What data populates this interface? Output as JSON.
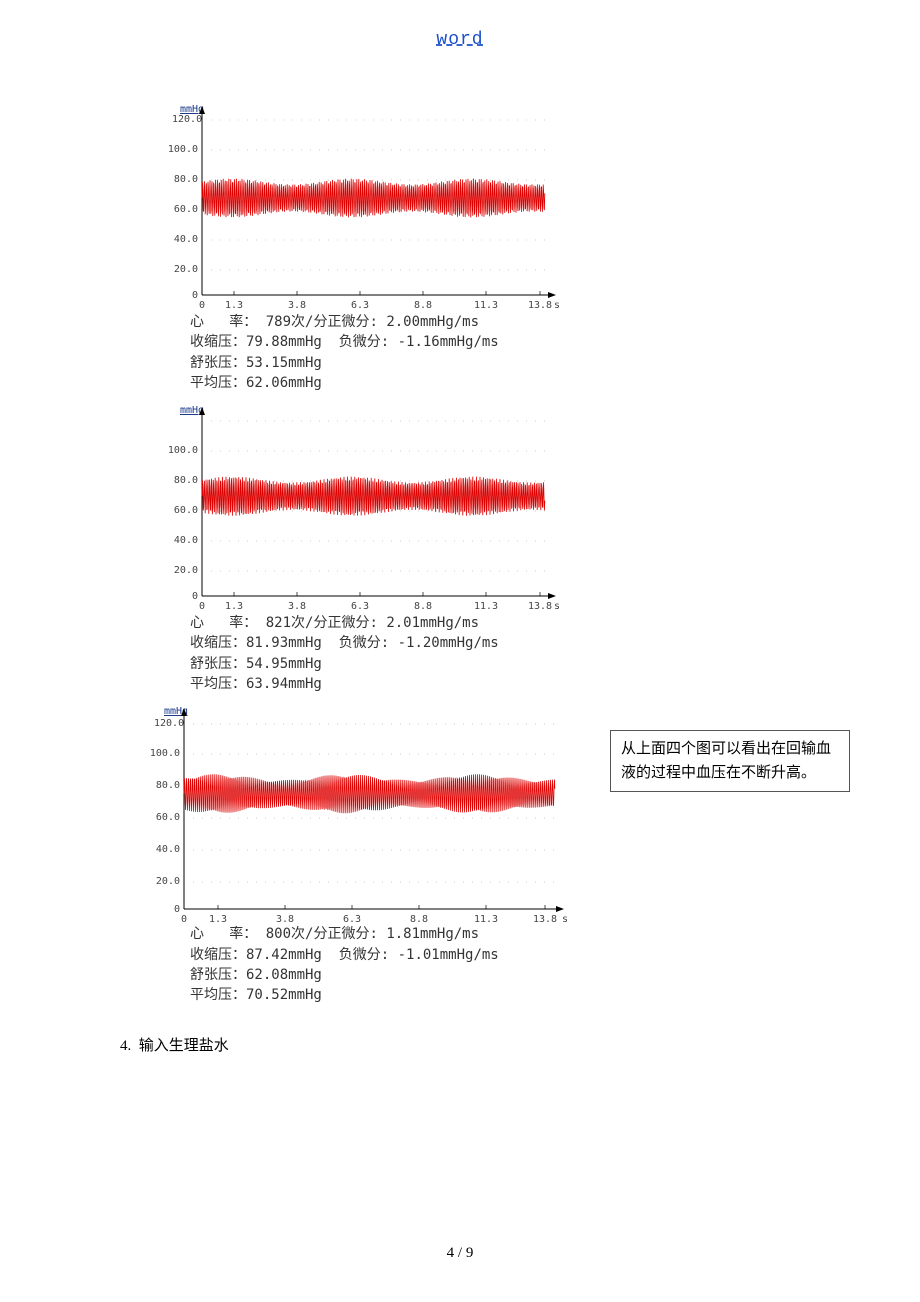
{
  "header": {
    "link_text": "word"
  },
  "callout": {
    "text": "从上面四个图可以看出在回输血液的过程中血压在不断升高。"
  },
  "list_item": {
    "number": "4.",
    "text": "输入生理盐水"
  },
  "footer": {
    "page_label": "4 / 9"
  },
  "ylabel_unit": "mmHg",
  "xunit": "s",
  "chart1": {
    "ylabel_top": "120.0",
    "yticks": [
      "100.0",
      "80.0",
      "60.0",
      "40.0",
      "20.0",
      "0"
    ],
    "xticks": [
      "0",
      "1.3",
      "3.8",
      "6.3",
      "8.8",
      "11.3",
      "13.8"
    ],
    "rate_label": "心   率：",
    "rate_value": "789次/分",
    "pos_diff_label": "正微分:",
    "pos_diff_value": "2.00mmHg/ms",
    "sys_label": "收缩压：",
    "sys_value": "79.88mmHg",
    "neg_diff_label": "负微分:",
    "neg_diff_value": "-1.16mmHg/ms",
    "dia_label": "舒张压：",
    "dia_value": "53.15mmHg",
    "mean_label": "平均压：",
    "mean_value": "62.06mmHg"
  },
  "chart2": {
    "ylabel_top": "mmHg",
    "yticks": [
      "100.0",
      "80.0",
      "60.0",
      "40.0",
      "20.0",
      "0"
    ],
    "xticks": [
      "0",
      "1.3",
      "3.8",
      "6.3",
      "8.8",
      "11.3",
      "13.8"
    ],
    "rate_label": "心   率：",
    "rate_value": "821次/分",
    "pos_diff_label": "正微分:",
    "pos_diff_value": "2.01mmHg/ms",
    "sys_label": "收缩压：",
    "sys_value": "81.93mmHg",
    "neg_diff_label": "负微分:",
    "neg_diff_value": "-1.20mmHg/ms",
    "dia_label": "舒张压：",
    "dia_value": "54.95mmHg",
    "mean_label": "平均压：",
    "mean_value": "63.94mmHg"
  },
  "chart3": {
    "ylabel_top": "mmHg",
    "ylabel_top2": "120.0",
    "yticks": [
      "100.0",
      "80.0",
      "60.0",
      "40.0",
      "20.0",
      "0"
    ],
    "xticks": [
      "0",
      "1.3",
      "3.8",
      "6.3",
      "8.8",
      "11.3",
      "13.8"
    ],
    "rate_label": "心   率：",
    "rate_value": "800次/分",
    "pos_diff_label": "正微分:",
    "pos_diff_value": "1.81mmHg/ms",
    "sys_label": "收缩压：",
    "sys_value": "87.42mmHg",
    "neg_diff_label": "负微分:",
    "neg_diff_value": "-1.01mmHg/ms",
    "dia_label": "舒张压：",
    "dia_value": "62.08mmHg",
    "mean_label": "平均压：",
    "mean_value": "70.52mmHg"
  },
  "chart_data": [
    {
      "type": "line",
      "title": "",
      "xlabel": "s",
      "ylabel": "mmHg",
      "xlim": [
        0,
        13.8
      ],
      "ylim": [
        0,
        120
      ],
      "x_ticks": [
        0,
        1.3,
        3.8,
        6.3,
        8.8,
        11.3,
        13.8
      ],
      "y_ticks": [
        0,
        20,
        40,
        60,
        80,
        100,
        120
      ],
      "series": [
        {
          "name": "血压",
          "oscillation_hz_approx": 13.2,
          "low": 53.15,
          "high": 79.88,
          "mean": 62.06
        }
      ],
      "stats": {
        "heart_rate_per_min": 789,
        "pos_diff_mmHg_ms": 2.0,
        "neg_diff_mmHg_ms": -1.16,
        "systolic_mmHg": 79.88,
        "diastolic_mmHg": 53.15,
        "mean_mmHg": 62.06
      }
    },
    {
      "type": "line",
      "xlabel": "s",
      "ylabel": "mmHg",
      "xlim": [
        0,
        13.8
      ],
      "ylim": [
        0,
        120
      ],
      "x_ticks": [
        0,
        1.3,
        3.8,
        6.3,
        8.8,
        11.3,
        13.8
      ],
      "y_ticks": [
        0,
        20,
        40,
        60,
        80,
        100
      ],
      "series": [
        {
          "name": "血压",
          "oscillation_hz_approx": 13.7,
          "low": 54.95,
          "high": 81.93,
          "mean": 63.94
        }
      ],
      "stats": {
        "heart_rate_per_min": 821,
        "pos_diff_mmHg_ms": 2.01,
        "neg_diff_mmHg_ms": -1.2,
        "systolic_mmHg": 81.93,
        "diastolic_mmHg": 54.95,
        "mean_mmHg": 63.94
      }
    },
    {
      "type": "line",
      "xlabel": "s",
      "ylabel": "mmHg",
      "xlim": [
        0,
        13.8
      ],
      "ylim": [
        0,
        120
      ],
      "x_ticks": [
        0,
        1.3,
        3.8,
        6.3,
        8.8,
        11.3,
        13.8
      ],
      "y_ticks": [
        0,
        20,
        40,
        60,
        80,
        100,
        120
      ],
      "series": [
        {
          "name": "血压",
          "oscillation_hz_approx": 13.3,
          "low": 62.08,
          "high": 87.42,
          "mean": 70.52
        }
      ],
      "stats": {
        "heart_rate_per_min": 800,
        "pos_diff_mmHg_ms": 1.81,
        "neg_diff_mmHg_ms": -1.01,
        "systolic_mmHg": 87.42,
        "diastolic_mmHg": 62.08,
        "mean_mmHg": 70.52
      }
    }
  ]
}
